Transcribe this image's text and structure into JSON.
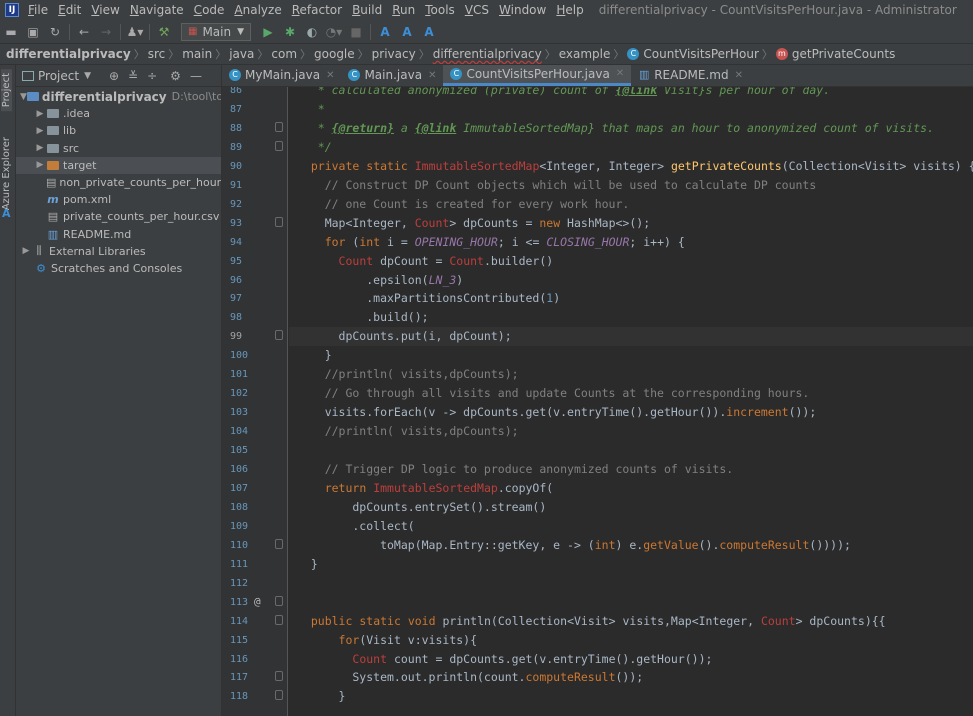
{
  "menubar": {
    "logo": "IJ",
    "items": [
      "File",
      "Edit",
      "View",
      "Navigate",
      "Code",
      "Analyze",
      "Refactor",
      "Build",
      "Run",
      "Tools",
      "VCS",
      "Window",
      "Help"
    ],
    "window_title": "differentialprivacy - CountVisitsPerHour.java - Administrator"
  },
  "toolbar": {
    "run_config": "Main"
  },
  "breadcrumb": {
    "root": "differentialprivacy",
    "items": [
      "src",
      "main",
      "java",
      "com",
      "google",
      "privacy",
      "differentialprivacy",
      "example",
      "CountVisitsPerHour",
      "getPrivateCounts"
    ]
  },
  "sidebar": {
    "vertical_tabs": [
      "Project",
      "Azure Explorer"
    ]
  },
  "project_panel": {
    "title": "Project",
    "root": {
      "name": "differentialprivacy",
      "path": "D:\\tool\\tool\\"
    },
    "items": [
      {
        "label": ".idea",
        "icon": "folder"
      },
      {
        "label": "lib",
        "icon": "folder"
      },
      {
        "label": "src",
        "icon": "folder"
      },
      {
        "label": "target",
        "icon": "folder-orange"
      },
      {
        "label": "non_private_counts_per_hour.csv",
        "icon": "csv-file"
      },
      {
        "label": "pom.xml",
        "icon": "maven-file"
      },
      {
        "label": "private_counts_per_hour.csv",
        "icon": "csv-file"
      },
      {
        "label": "README.md",
        "icon": "markdown-file"
      },
      {
        "label": "External Libraries",
        "icon": "library"
      },
      {
        "label": "Scratches and Consoles",
        "icon": "scratch"
      }
    ]
  },
  "editor_tabs": [
    {
      "label": "MyMain.java",
      "icon": "java-class-icon",
      "active": false
    },
    {
      "label": "Main.java",
      "icon": "java-class-icon",
      "active": false
    },
    {
      "label": "CountVisitsPerHour.java",
      "icon": "java-class-icon",
      "active": true
    },
    {
      "label": "README.md",
      "icon": "markdown-icon",
      "active": false
    }
  ],
  "editor": {
    "current_line": "99",
    "line_numbers": [
      "86",
      "87",
      "88",
      "89",
      "90",
      "91",
      "92",
      "93",
      "94",
      "95",
      "96",
      "97",
      "98",
      "99",
      "100",
      "101",
      "102",
      "103",
      "104",
      "105",
      "106",
      "107",
      "108",
      "109",
      "110",
      "111",
      "112",
      "113",
      "114",
      "115",
      "116",
      "117",
      "118"
    ],
    "lines": [
      "   * calculated anonymized (private) count of {@link Visit}s per hour of day.",
      "   *",
      "   * {@return} a {@link ImmutableSortedMap} that maps an hour to anonymized count of visits.",
      "   */",
      "  private static ImmutableSortedMap<Integer, Integer> getPrivateCounts(Collection<Visit> visits) {",
      "    // Construct DP Count objects which will be used to calculate DP counts",
      "    // one Count is created for every work hour.",
      "    Map<Integer, Count> dpCounts = new HashMap<>();",
      "    for (int i = OPENING_HOUR; i <= CLOSING_HOUR; i++) {",
      "      Count dpCount = Count.builder()",
      "          .epsilon(LN_3)",
      "          .maxPartitionsContributed(1)",
      "          .build();",
      "      dpCounts.put(i, dpCount);",
      "    }",
      "    //println( visits,dpCounts);",
      "    // Go through all visits and update Counts at the corresponding hours.",
      "    visits.forEach(v -> dpCounts.get(v.entryTime().getHour()).increment());",
      "    //println( visits,dpCounts);",
      "",
      "    // Trigger DP logic to produce anonymized counts of visits.",
      "    return ImmutableSortedMap.copyOf(",
      "        dpCounts.entrySet().stream()",
      "        .collect(",
      "            toMap(Map.Entry::getKey, e -> (int) e.getValue().computeResult())));",
      "  }",
      "",
      "",
      "  public static void println(Collection<Visit> visits,Map<Integer, Count> dpCounts){{",
      "      for(Visit v:visits){",
      "        Count count = dpCounts.get(v.entryTime().getHour());",
      "        System.out.println(count.computeResult());",
      "      }",
      "  }}"
    ]
  }
}
